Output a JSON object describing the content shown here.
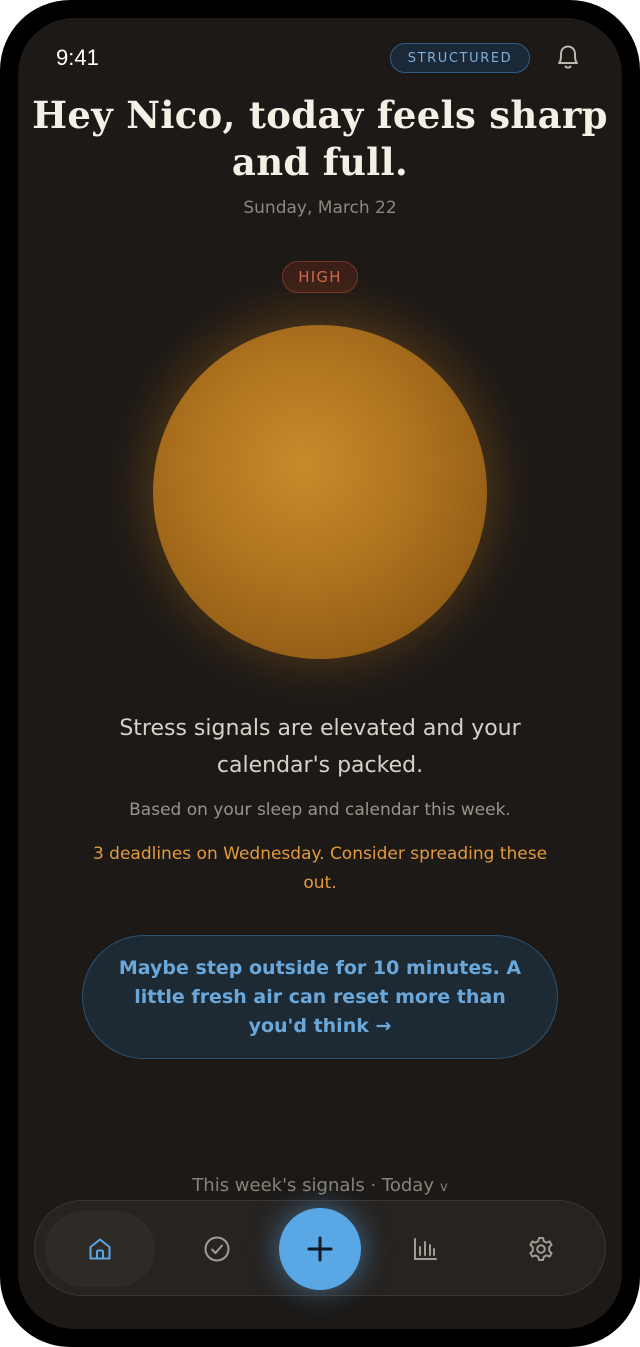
{
  "status_bar": {
    "time": "9:41"
  },
  "header": {
    "mode_badge": "STRUCTURED",
    "greeting": "Hey Nico, today feels sharp and full.",
    "date": "Sunday, March 22"
  },
  "insight": {
    "level": "HIGH",
    "headline": "Stress signals are elevated and your calendar's packed.",
    "basis": "Based on your sleep and calendar this week.",
    "alert": "3 deadlines on Wednesday. Consider spreading these out."
  },
  "suggestion": {
    "text": "Maybe step outside for 10 minutes. A little fresh air can reset more than you'd think →"
  },
  "week_signals": {
    "label": "This week's signals · Today",
    "chevron": "v"
  },
  "nav": {
    "items": [
      {
        "name": "home",
        "icon": "home-icon",
        "active": true
      },
      {
        "name": "tasks",
        "icon": "check-circle-icon",
        "active": false
      },
      {
        "name": "add",
        "icon": "plus-icon",
        "active": false
      },
      {
        "name": "stats",
        "icon": "bar-chart-icon",
        "active": false
      },
      {
        "name": "settings",
        "icon": "gear-icon",
        "active": false
      }
    ]
  },
  "colors": {
    "background": "#1c1917",
    "accent_blue": "#5aa7e6",
    "orb": "#b17520",
    "alert": "#e39a3c",
    "high_level": "#d06a4e"
  }
}
